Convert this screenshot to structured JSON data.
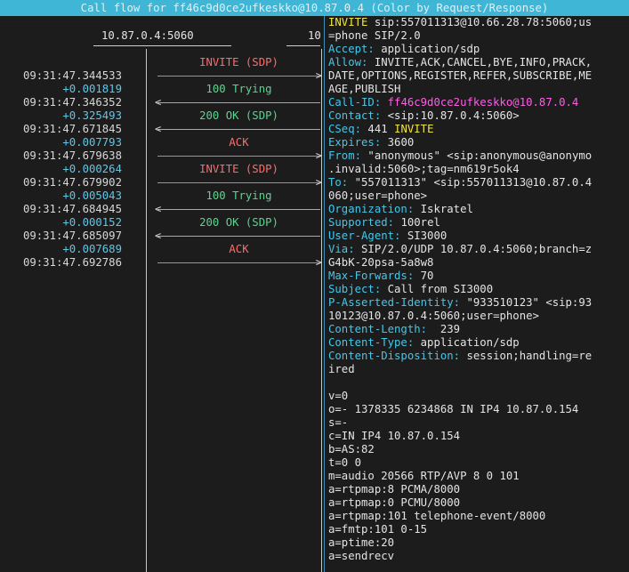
{
  "title": "Call flow for ff46c9d0ce2ufkeskko@10.87.0.4 (Color by Request/Response)",
  "hosts": {
    "a": "10.87.0.4:5060",
    "b": "10"
  },
  "timestamps": [
    {
      "abs": "09:31:47.344533",
      "rel": "+0.001819"
    },
    {
      "abs": "09:31:47.346352",
      "rel": "+0.325493"
    },
    {
      "abs": "09:31:47.671845",
      "rel": "+0.007793"
    },
    {
      "abs": "09:31:47.679638",
      "rel": "+0.000264"
    },
    {
      "abs": "09:31:47.679902",
      "rel": "+0.005043"
    },
    {
      "abs": "09:31:47.684945",
      "rel": "+0.000152"
    },
    {
      "abs": "09:31:47.685097",
      "rel": "+0.007689"
    },
    {
      "abs": "09:31:47.692786",
      "rel": ""
    }
  ],
  "messages": [
    {
      "label": "INVITE (SDP)",
      "color": "#ff6b6b",
      "direction": "right"
    },
    {
      "label": "100 Trying",
      "color": "#58d68d",
      "direction": "left"
    },
    {
      "label": "200 OK (SDP)",
      "color": "#58d68d",
      "direction": "left"
    },
    {
      "label": "ACK",
      "color": "#ff6b6b",
      "direction": "right"
    },
    {
      "label": "INVITE (SDP)",
      "color": "#ff6b6b",
      "direction": "right"
    },
    {
      "label": "100 Trying",
      "color": "#58d68d",
      "direction": "left"
    },
    {
      "label": "200 OK (SDP)",
      "color": "#58d68d",
      "direction": "left"
    },
    {
      "label": "ACK",
      "color": "#ff6b6b",
      "direction": "right"
    }
  ],
  "sip": {
    "request_line_1": "INVITE",
    "request_line_1_rest": " sip:557011313@10.66.28.78:5060;us",
    "request_line_2": "=phone SIP/2.0",
    "accept": {
      "name": "Accept:",
      "value": " application/sdp"
    },
    "allow": {
      "name": "Allow:",
      "value": " INVITE,ACK,CANCEL,BYE,INFO,PRACK,"
    },
    "allow_2": "DATE,OPTIONS,REGISTER,REFER,SUBSCRIBE,ME",
    "allow_3": "AGE,PUBLISH",
    "call_id": {
      "name": "Call-ID:",
      "value": " ff46c9d0ce2ufkeskko@10.87.0.4"
    },
    "contact": {
      "name": "Contact:",
      "value": " <sip:10.87.0.4:5060>"
    },
    "cseq": {
      "name": "CSeq:",
      "num": " 441 ",
      "method": "INVITE"
    },
    "expires": {
      "name": "Expires:",
      "value": " 3600"
    },
    "from": {
      "name": "From:",
      "value": " \"anonymous\" <sip:anonymous@anonymo"
    },
    "from_2": ".invalid:5060>;tag=nm619r5ok4",
    "to": {
      "name": "To:",
      "value": " \"557011313\" <sip:557011313@10.87.0.4"
    },
    "to_2": "060;user=phone>",
    "organization": {
      "name": "Organization:",
      "value": " Iskratel"
    },
    "supported": {
      "name": "Supported:",
      "value": " 100rel"
    },
    "user_agent": {
      "name": "User-Agent:",
      "value": " SI3000"
    },
    "via": {
      "name": "Via:",
      "value": " SIP/2.0/UDP 10.87.0.4:5060;branch=z"
    },
    "via_2": "G4bK-20psa-5a8w8",
    "max_forwards": {
      "name": "Max-Forwards:",
      "value": " 70"
    },
    "subject": {
      "name": "Subject:",
      "value": " Call from SI3000"
    },
    "pai": {
      "name": "P-Asserted-Identity:",
      "value": " \"933510123\" <sip:93"
    },
    "pai_2": "10123@10.87.0.4:5060;user=phone>",
    "content_length": {
      "name": "Content-Length:",
      "value": "  239"
    },
    "content_type": {
      "name": "Content-Type:",
      "value": " application/sdp"
    },
    "content_disposition": {
      "name": "Content-Disposition:",
      "value": " session;handling=re"
    },
    "content_disposition_2": "ired"
  },
  "sdp": [
    "v=0",
    "o=- 1378335 6234868 IN IP4 10.87.0.154",
    "s=-",
    "c=IN IP4 10.87.0.154",
    "b=AS:82",
    "t=0 0",
    "m=audio 20566 RTP/AVP 8 0 101",
    "a=rtpmap:8 PCMA/8000",
    "a=rtpmap:0 PCMU/8000",
    "a=rtpmap:101 telephone-event/8000",
    "a=fmtp:101 0-15",
    "a=ptime:20",
    "a=sendrecv"
  ]
}
